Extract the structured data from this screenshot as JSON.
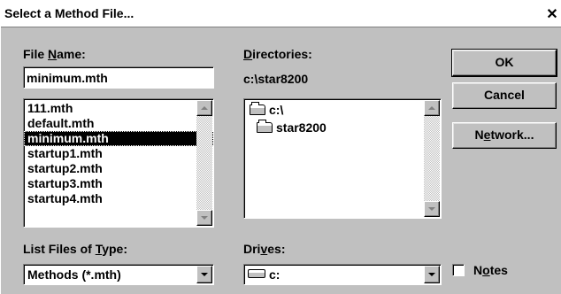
{
  "window": {
    "title": "Select a Method File...",
    "close_glyph": "✕"
  },
  "file_name": {
    "label_pre": "File ",
    "label_ul": "N",
    "label_post": "ame:",
    "value": "minimum.mth",
    "files": [
      {
        "name": "111.mth",
        "selected": false
      },
      {
        "name": "default.mth",
        "selected": false
      },
      {
        "name": "minimum.mth",
        "selected": true
      },
      {
        "name": "startup1.mth",
        "selected": false
      },
      {
        "name": "startup2.mth",
        "selected": false
      },
      {
        "name": "startup3.mth",
        "selected": false
      },
      {
        "name": "startup4.mth",
        "selected": false
      }
    ]
  },
  "directories": {
    "label_ul": "D",
    "label_post": "irectories:",
    "current_path": "c:\\star8200",
    "items": [
      {
        "name": "c:\\",
        "icon": "open-folder-icon"
      },
      {
        "name": "star8200",
        "icon": "open-folder-icon"
      }
    ]
  },
  "file_type": {
    "label_pre": "List Files of ",
    "label_ul": "T",
    "label_post": "ype:",
    "selected": "Methods (*.mth)"
  },
  "drives": {
    "label_pre": "Dri",
    "label_ul": "v",
    "label_post": "es:",
    "selected": "c:",
    "icon": "drive-icon"
  },
  "buttons": {
    "ok": "OK",
    "cancel": "Cancel",
    "network_pre": "N",
    "network_ul": "e",
    "network_post": "twork..."
  },
  "notes": {
    "label_pre": "N",
    "label_ul": "o",
    "label_post": "tes",
    "checked": false
  }
}
